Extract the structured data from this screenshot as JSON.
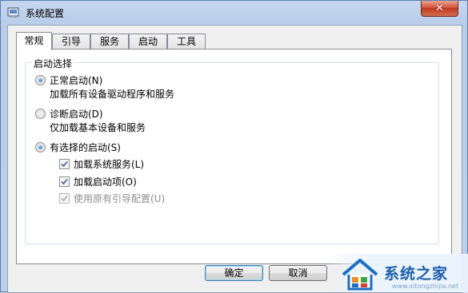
{
  "window": {
    "title": "系统配置",
    "close_label": "✕"
  },
  "tabs": [
    {
      "label": "常规",
      "active": true
    },
    {
      "label": "引导",
      "active": false
    },
    {
      "label": "服务",
      "active": false
    },
    {
      "label": "启动",
      "active": false
    },
    {
      "label": "工具",
      "active": false
    }
  ],
  "startup_group": {
    "title": "启动选择",
    "normal": {
      "label": "正常启动(N)",
      "description": "加载所有设备驱动程序和服务",
      "checked": true
    },
    "diagnostic": {
      "label": "诊断启动(D)",
      "description": "仅加载基本设备和服务",
      "checked": false
    },
    "selective": {
      "label": "有选择的启动(S)",
      "checked": true,
      "options": [
        {
          "label": "加载系统服务(L)",
          "checked": true,
          "enabled": true
        },
        {
          "label": "加载启动项(O)",
          "checked": true,
          "enabled": true
        },
        {
          "label": "使用原有引导配置(U)",
          "checked": true,
          "enabled": false
        }
      ]
    }
  },
  "buttons": {
    "ok": "确定",
    "cancel": "取消"
  },
  "watermark": {
    "text": "系统之家",
    "url": "www.xitongzhijia.net"
  },
  "colors": {
    "titlebar": "#bcd0ea",
    "close_button": "#c7442b",
    "accent": "#1c66b8",
    "watermark_text": "#1b5faa"
  }
}
